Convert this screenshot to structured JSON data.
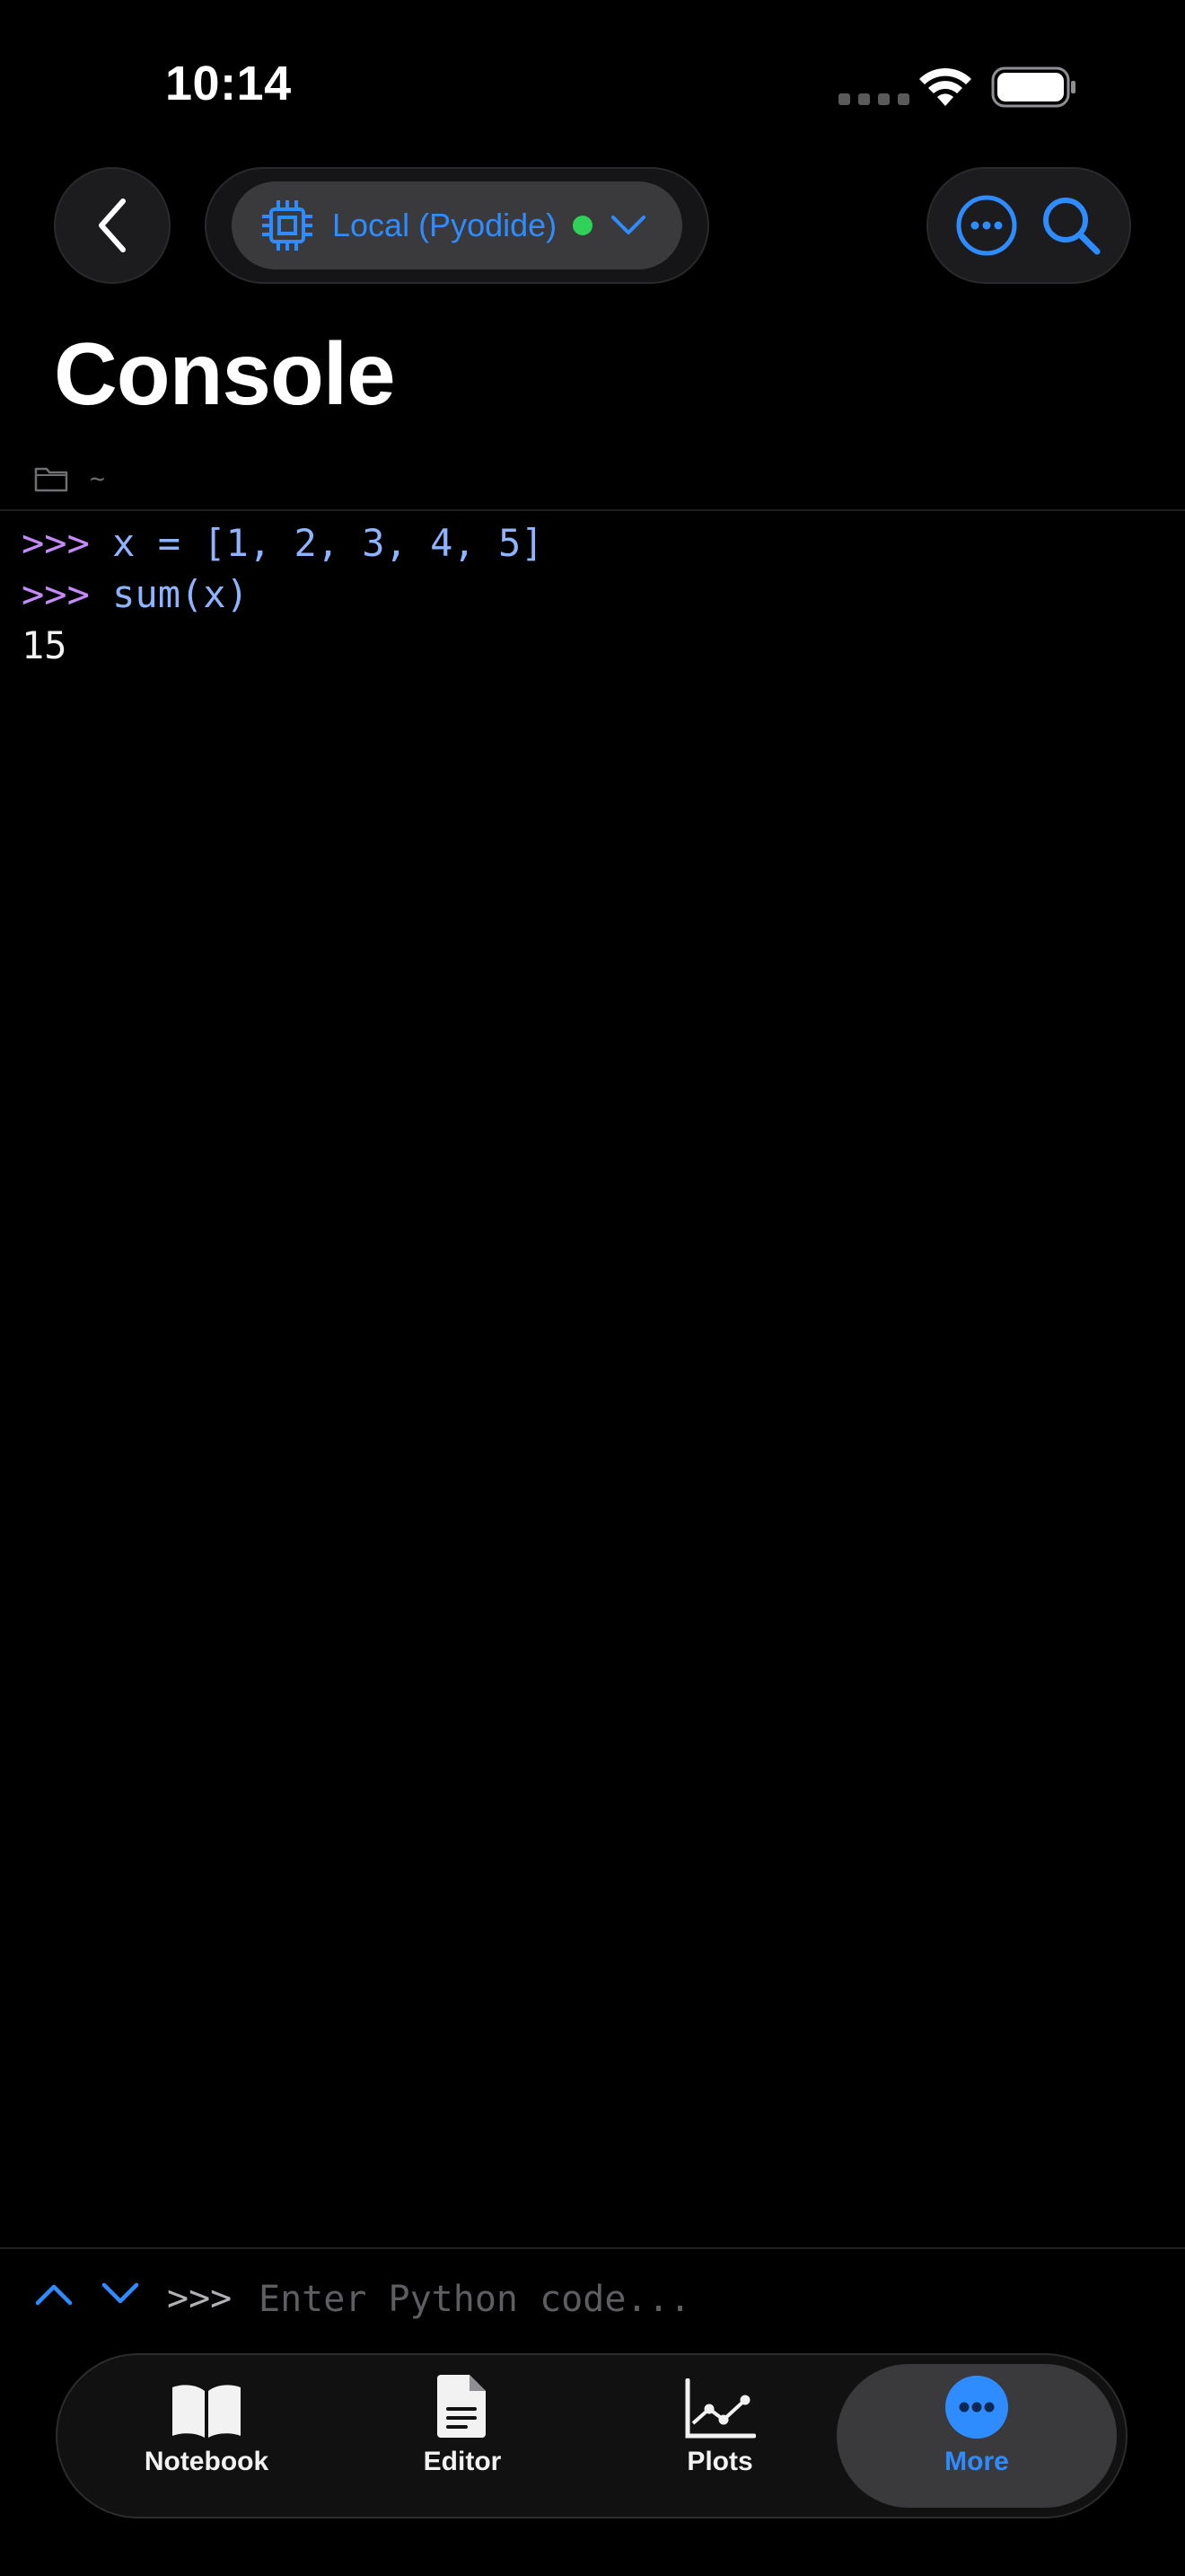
{
  "status_bar": {
    "time": "10:14"
  },
  "nav": {
    "kernel_label": "Local (Pyodide)",
    "kernel_status_color": "#30d158",
    "accent_color": "#2f8cff"
  },
  "page": {
    "title": "Console",
    "path": "~"
  },
  "console": {
    "lines": [
      {
        "prompt": ">>>",
        "code": "x = [1, 2, 3, 4, 5]"
      },
      {
        "prompt": ">>>",
        "code": "sum(x)"
      },
      {
        "output": "15"
      }
    ]
  },
  "input": {
    "prompt": ">>>",
    "placeholder": "Enter Python code...",
    "value": ""
  },
  "tabs": [
    {
      "label": "Notebook",
      "icon": "book-icon"
    },
    {
      "label": "Editor",
      "icon": "document-icon"
    },
    {
      "label": "Plots",
      "icon": "chart-line-icon"
    },
    {
      "label": "More",
      "icon": "ellipsis-circle-icon",
      "selected": true
    }
  ]
}
